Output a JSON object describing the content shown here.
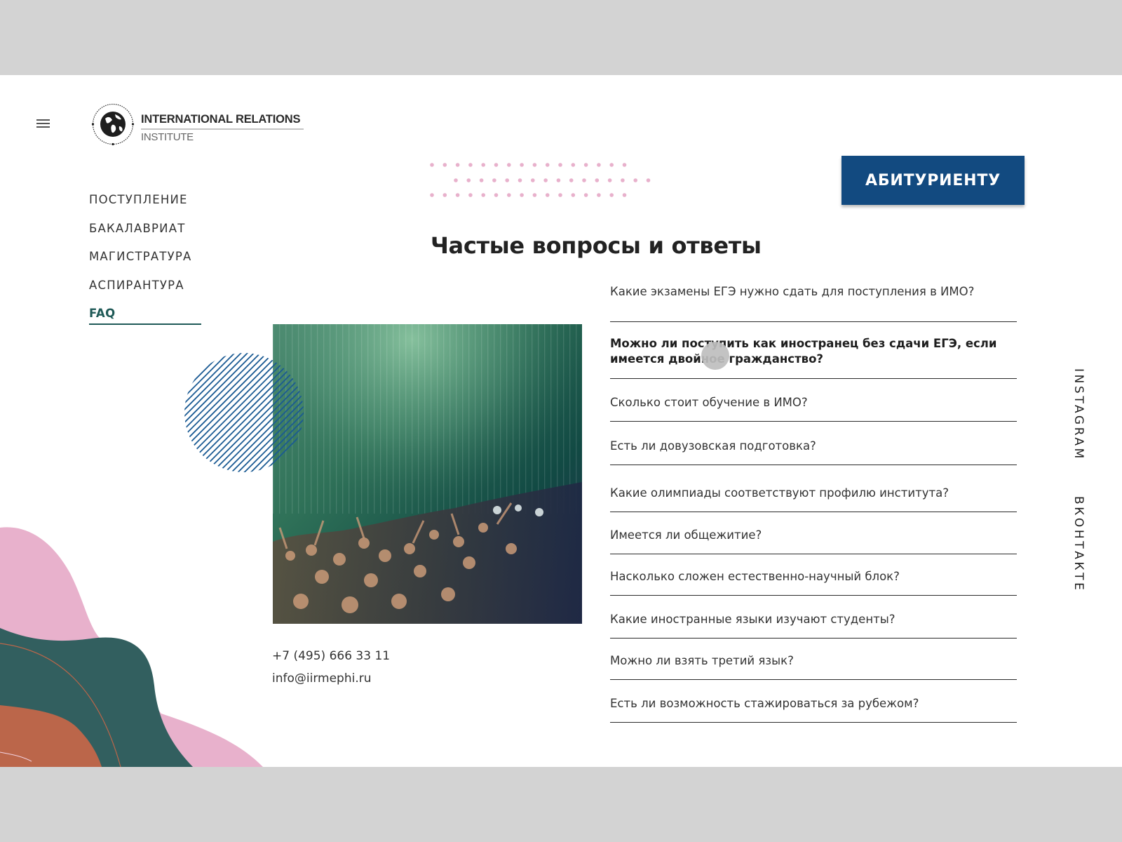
{
  "header": {
    "menu_icon": "hamburger-menu-icon",
    "logo": {
      "icon": "globe-icon",
      "title": "INTERNATIONAL RELATIONS",
      "subtitle": "INSTITUTE"
    },
    "cta_label": "АБИТУРИЕНТУ"
  },
  "nav": {
    "items": [
      {
        "label": "ПОСТУПЛЕНИЕ",
        "active": false
      },
      {
        "label": "БАКАЛАВРИАТ",
        "active": false
      },
      {
        "label": "МАГИСТРАТУРА",
        "active": false
      },
      {
        "label": "АСПИРАНТУРА",
        "active": false
      },
      {
        "label": "FAQ",
        "active": true
      }
    ]
  },
  "main": {
    "title": "Частые вопросы и ответы",
    "faq": [
      {
        "question": "Какие экзамены ЕГЭ нужно сдать для поступления в ИМО?",
        "open": false
      },
      {
        "question": "Можно ли поступить как иностранец без сдачи ЕГЭ, если имеется двойное гражданство?",
        "open": true
      },
      {
        "question": "Сколько стоит обучение в ИМО?",
        "open": false
      },
      {
        "question": "Есть ли довузовская подготовка?",
        "open": false
      },
      {
        "question": "Какие олимпиады соответствуют профилю института?",
        "open": false
      },
      {
        "question": "Имеется ли общежитие?",
        "open": false
      },
      {
        "question": "Насколько сложен естественно-научный блок?",
        "open": false
      },
      {
        "question": "Какие иностранные языки изучают студенты?",
        "open": false
      },
      {
        "question": "Можно ли взять третий язык?",
        "open": false
      },
      {
        "question": "Есть ли возможность стажироваться за рубежом?",
        "open": false
      }
    ]
  },
  "contacts": {
    "phone": "+7 (495) 666 33 11",
    "email": "info@iirmephi.ru"
  },
  "social": {
    "instagram": "INSTAGRAM",
    "vk": "ВКОНТАКТЕ"
  },
  "colors": {
    "brand_blue": "#124a80",
    "accent_green": "#1f5a57",
    "pink": "#e8b1cc",
    "teal": "#325f5f",
    "terracotta": "#bb664a"
  }
}
